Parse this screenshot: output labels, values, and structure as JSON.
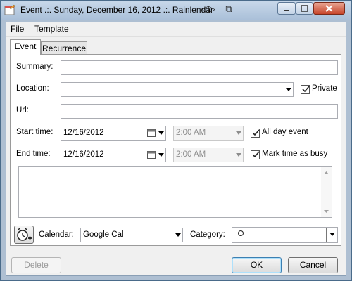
{
  "window": {
    "title": "Event .:. Sunday, December 16, 2012 .:. Rainlendar"
  },
  "menu": {
    "file": "File",
    "template": "Template"
  },
  "tabs": {
    "event": "Event",
    "recurrence": "Recurrence",
    "active": "Event"
  },
  "form": {
    "summary_label": "Summary:",
    "summary_value": "",
    "location_label": "Location:",
    "location_value": "",
    "private_label": "Private",
    "private_checked": true,
    "url_label": "Url:",
    "url_value": "",
    "start_label": "Start time:",
    "start_date": "12/16/2012",
    "start_time": "2:00 AM",
    "all_day_label": "All day event",
    "all_day_checked": true,
    "end_label": "End time:",
    "end_date": "12/16/2012",
    "end_time": "2:00 AM",
    "busy_label": "Mark time as busy",
    "busy_checked": true,
    "notes_value": ""
  },
  "bottom": {
    "calendar_label": "Calendar:",
    "calendar_value": "Google Cal",
    "category_label": "Category:",
    "category_value": "",
    "alarm_icon": "alarm-clock-add-icon"
  },
  "buttons": {
    "delete": "Delete",
    "ok": "OK",
    "cancel": "Cancel"
  },
  "colors": {
    "titlebar": "#b6c9df",
    "frame": "#aebfd2",
    "client": "#f0f0f0",
    "close_button": "#c7442a"
  }
}
